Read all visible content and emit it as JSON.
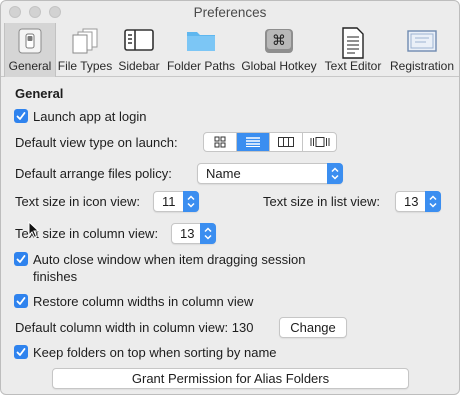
{
  "window": {
    "title": "Preferences"
  },
  "toolbar": {
    "items": [
      {
        "label": "General",
        "icon": "general-switch-icon",
        "selected": true
      },
      {
        "label": "File Types",
        "icon": "file-types-icon"
      },
      {
        "label": "Sidebar",
        "icon": "sidebar-icon"
      },
      {
        "label": "Folder Paths",
        "icon": "folder-icon"
      },
      {
        "label": "Global Hotkey",
        "icon": "command-key-icon"
      },
      {
        "label": "Text Editor",
        "icon": "text-document-icon"
      },
      {
        "label": "Registration",
        "icon": "certificate-icon"
      }
    ]
  },
  "general": {
    "section_title": "General",
    "launch_at_login": {
      "label": "Launch app at login",
      "checked": true
    },
    "default_view_label": "Default view type on launch:",
    "view_modes": [
      "icon-view",
      "list-view",
      "column-view",
      "gallery-view"
    ],
    "view_selected": "list-view",
    "arrange_label": "Default arrange files policy:",
    "arrange_value": "Name",
    "icon_text_size_label": "Text size in icon view:",
    "icon_text_size_value": "11",
    "list_text_size_label": "Text size in list view:",
    "list_text_size_value": "13",
    "column_text_size_label": "Text size in column view:",
    "column_text_size_value": "13",
    "auto_close": {
      "label_line1": "Auto close window when item dragging session",
      "label_line2": "finishes",
      "checked": true
    },
    "restore_columns": {
      "label": "Restore column widths in column view",
      "checked": true
    },
    "column_width_label": "Default column width in column view: 130",
    "change_button": "Change",
    "folders_on_top": {
      "label": "Keep folders on top when sorting by name",
      "checked": true
    },
    "grant_button": "Grant Permission for Alias Folders"
  },
  "colors": {
    "accent": "#3b8ef0",
    "checkbox": "#2f83ee",
    "window_bg": "#ececec"
  }
}
